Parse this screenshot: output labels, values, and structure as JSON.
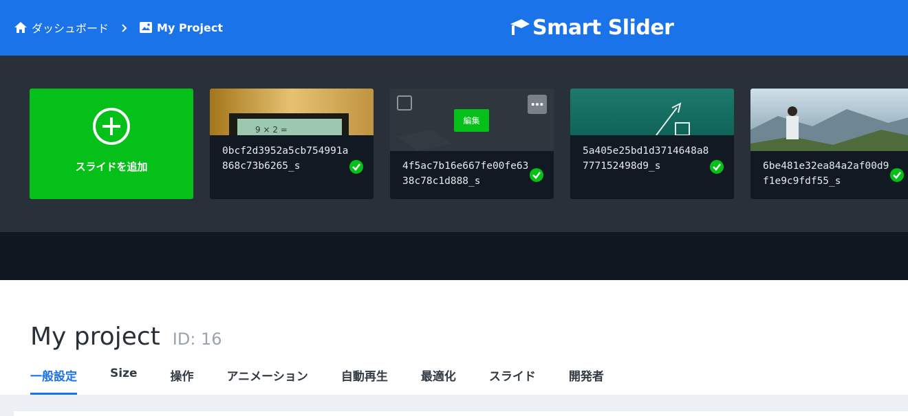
{
  "breadcrumb": {
    "dashboard": "ダッシュボード",
    "project": "My Project"
  },
  "logo": {
    "text": "Smart Slider"
  },
  "slides": {
    "add_label": "スライドを追加",
    "items": [
      {
        "name": "0bcf2d3952a5cb754991a868c73b6265_s"
      },
      {
        "name": "4f5ac7b16e667fe00fe6338c78c1d888_s",
        "edit_label": "編集"
      },
      {
        "name": "5a405e25bd1d3714648a8777152498d9_s"
      },
      {
        "name": "6be481e32ea84a2af00d9f1e9c9fdf55_s"
      }
    ]
  },
  "project": {
    "title": "My project",
    "id_label": "ID: 16"
  },
  "tabs": [
    {
      "label": "一般設定",
      "active": true
    },
    {
      "label": "Size"
    },
    {
      "label": "操作"
    },
    {
      "label": "アニメーション"
    },
    {
      "label": "自動再生"
    },
    {
      "label": "最適化"
    },
    {
      "label": "スライド"
    },
    {
      "label": "開発者"
    }
  ],
  "colors": {
    "primary": "#1a73e8",
    "accent_green": "#04c018",
    "dark_bg": "#283039"
  },
  "icons": {
    "home": "home-icon",
    "chevron": "chevron-right-icon",
    "image": "image-icon",
    "plus": "plus-circle-icon",
    "check": "check-circle-icon",
    "more": "more-icon"
  }
}
